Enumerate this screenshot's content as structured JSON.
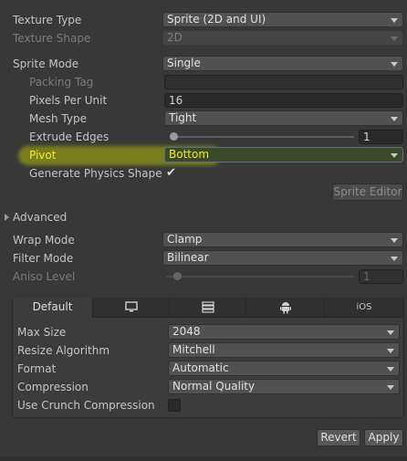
{
  "texture_type": {
    "label": "Texture Type",
    "value": "Sprite (2D and UI)"
  },
  "texture_shape": {
    "label": "Texture Shape",
    "value": "2D"
  },
  "sprite_mode": {
    "label": "Sprite Mode",
    "value": "Single"
  },
  "packing_tag": {
    "label": "Packing Tag",
    "value": ""
  },
  "pixels_per_unit": {
    "label": "Pixels Per Unit",
    "value": "16"
  },
  "mesh_type": {
    "label": "Mesh Type",
    "value": "Tight"
  },
  "extrude_edges": {
    "label": "Extrude Edges",
    "value": "1",
    "level": 0
  },
  "pivot": {
    "label": "Pivot",
    "value": "Bottom"
  },
  "generate_physics_shape": {
    "label": "Generate Physics Shape",
    "checked": true
  },
  "sprite_editor_label": "Sprite Editor",
  "advanced_label": "Advanced",
  "wrap_mode": {
    "label": "Wrap Mode",
    "value": "Clamp"
  },
  "filter_mode": {
    "label": "Filter Mode",
    "value": "Bilinear"
  },
  "aniso_level": {
    "label": "Aniso Level",
    "value": "1",
    "level": 0
  },
  "platform_tabs": {
    "default_label": "Default",
    "ios_label": "iOS",
    "icons": [
      "monitor-icon",
      "grid-icon",
      "android-icon"
    ]
  },
  "platform_settings": {
    "max_size": {
      "label": "Max Size",
      "value": "2048"
    },
    "resize_algorithm": {
      "label": "Resize Algorithm",
      "value": "Mitchell"
    },
    "format": {
      "label": "Format",
      "value": "Automatic"
    },
    "compression": {
      "label": "Compression",
      "value": "Normal Quality"
    },
    "use_crunch": {
      "label": "Use Crunch Compression",
      "checked": false
    }
  },
  "revert_label": "Revert",
  "apply_label": "Apply",
  "colors": {
    "pivot_text": "#f2ec20",
    "highlight": "#b0ba0a"
  }
}
